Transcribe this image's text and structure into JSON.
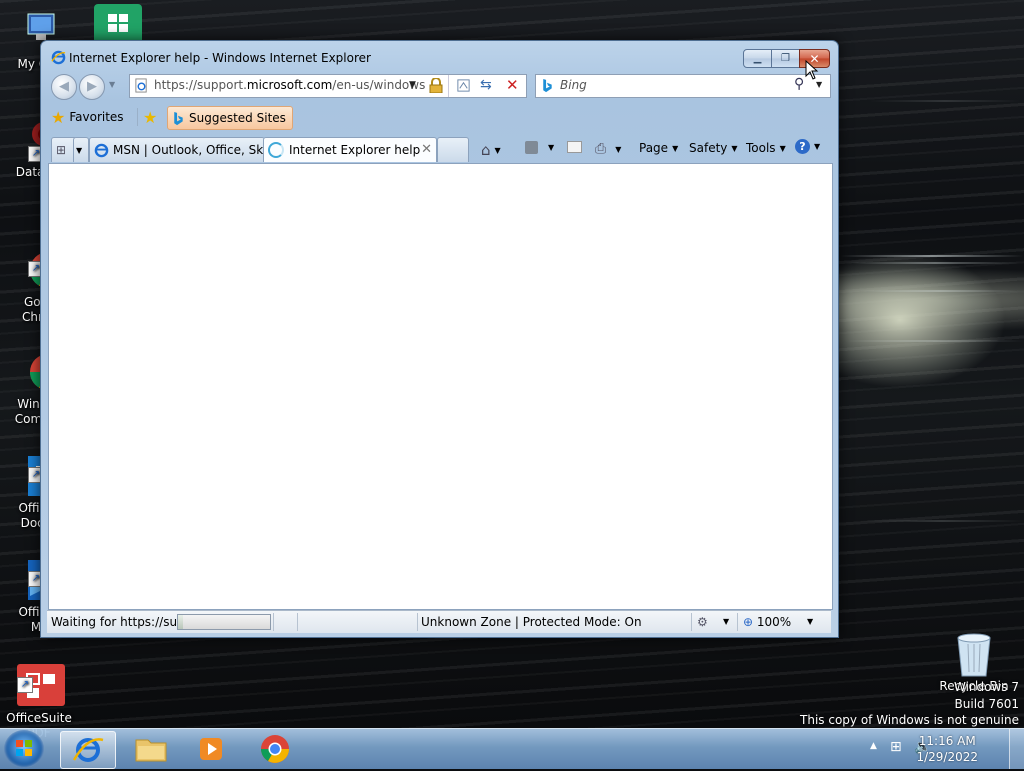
{
  "desktop": {
    "icons": [
      {
        "label": "My Co"
      },
      {
        "label": "DataW"
      },
      {
        "label": "Goo\nChro"
      },
      {
        "label": "Windo\nCompa"
      },
      {
        "label": "Office\nDocu"
      },
      {
        "label": "Office\nM"
      },
      {
        "label": "OfficeSuite\nPDF"
      },
      {
        "label": "Recycle Bin"
      }
    ],
    "watermark": {
      "line1": "Windows 7",
      "line2": "Build 7601",
      "line3": "This copy of Windows is not genuine"
    }
  },
  "window": {
    "title": "Internet Explorer help - Windows Internet Explorer",
    "address": {
      "url_prefix": "https://support.",
      "url_domain": "microsoft.com",
      "url_suffix": "/en-us/windows"
    },
    "search": {
      "placeholder": "Bing"
    },
    "favorites": {
      "label": "Favorites",
      "suggested": "Suggested Sites"
    },
    "tabs": [
      {
        "label": "MSN | Outlook, Office, Sk..."
      },
      {
        "label": "Internet Explorer help"
      }
    ],
    "commands": {
      "page": "Page",
      "safety": "Safety",
      "tools": "Tools"
    },
    "status": {
      "text": "Waiting for https://sup",
      "progress": 0.05,
      "zone": "Unknown Zone | Protected Mode: On",
      "zoom": "100%"
    }
  },
  "taskbar": {
    "time": "11:16 AM",
    "date": "1/29/2022"
  }
}
